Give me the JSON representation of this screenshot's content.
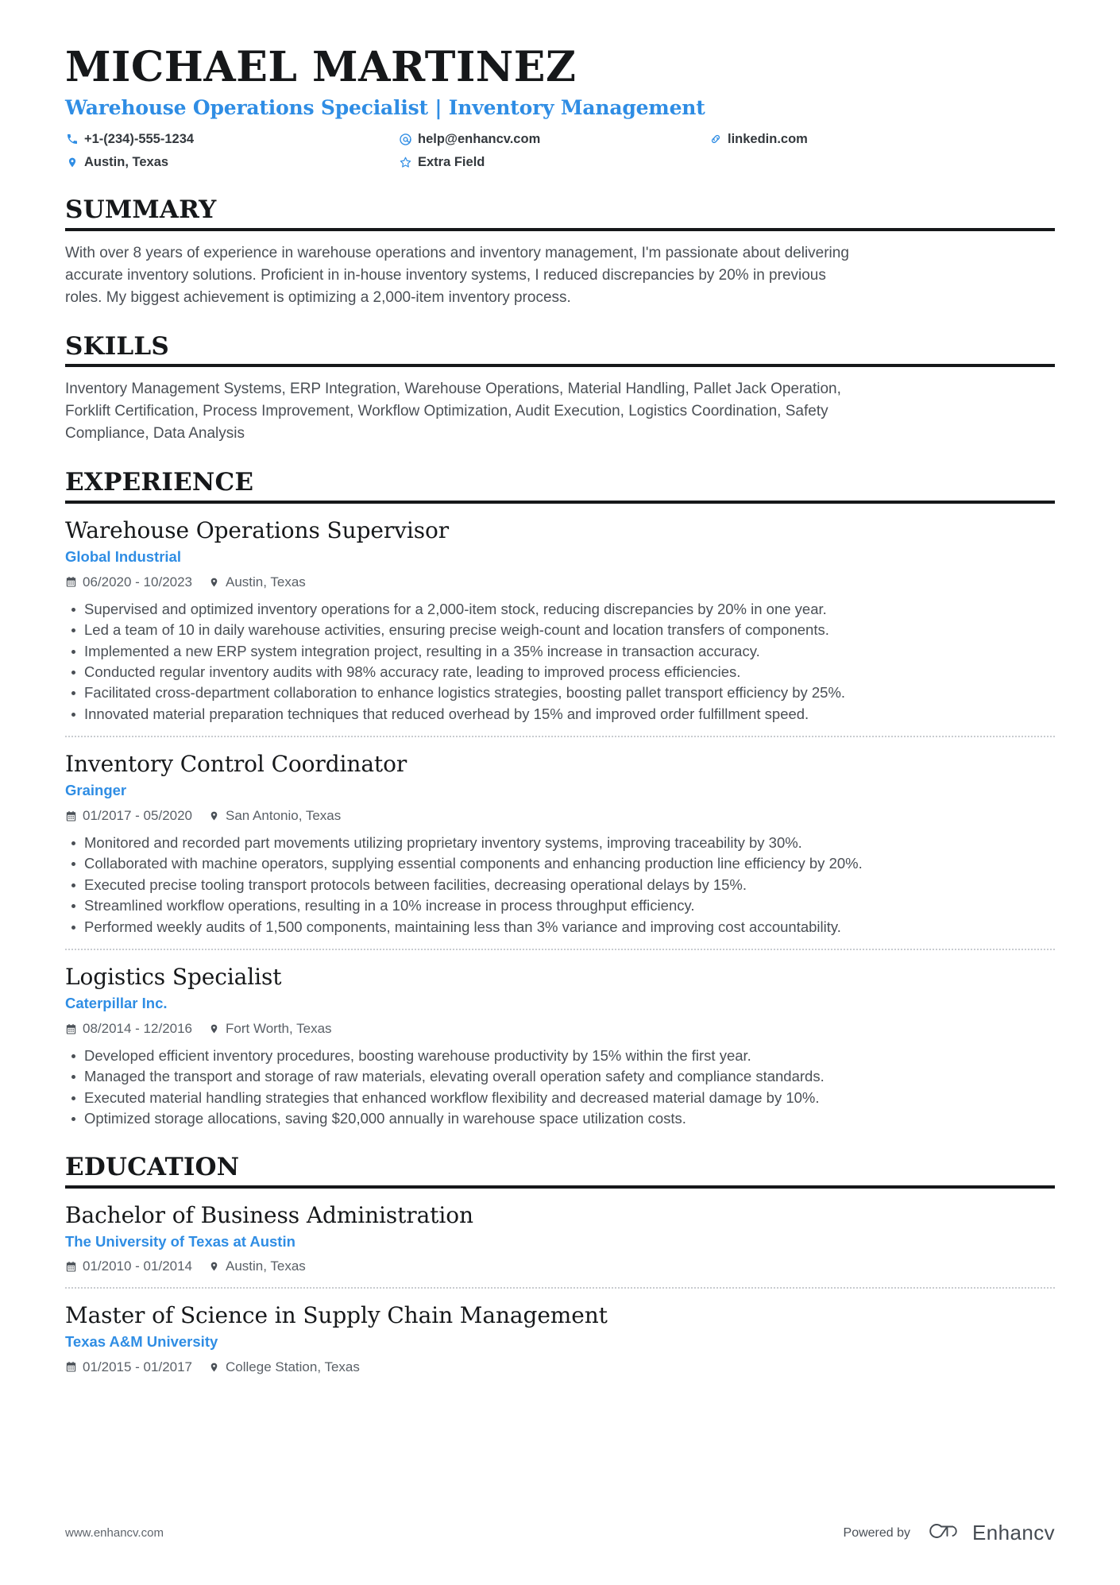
{
  "theme": {
    "accent": "#2f8de4",
    "ink": "#16181a",
    "body_text": "#4a4f55",
    "rule": "#16181a"
  },
  "header": {
    "name": "MICHAEL MARTINEZ",
    "headline": "Warehouse Operations Specialist | Inventory Management",
    "contacts": [
      {
        "icon": "phone-icon",
        "value": "+1-(234)-555-1234"
      },
      {
        "icon": "email-icon",
        "value": "help@enhancv.com"
      },
      {
        "icon": "link-icon",
        "value": "linkedin.com"
      },
      {
        "icon": "location-icon",
        "value": "Austin, Texas"
      },
      {
        "icon": "star-icon",
        "value": "Extra Field"
      }
    ]
  },
  "sections": {
    "summary": {
      "title": "SUMMARY",
      "text": "With over 8 years of experience in warehouse operations and inventory management, I'm passionate about delivering accurate inventory solutions. Proficient in in-house inventory systems, I reduced discrepancies by 20% in previous roles. My biggest achievement is optimizing a 2,000-item inventory process."
    },
    "skills": {
      "title": "SKILLS",
      "text": "Inventory Management Systems, ERP Integration, Warehouse Operations, Material Handling, Pallet Jack Operation, Forklift Certification, Process Improvement, Workflow Optimization, Audit Execution, Logistics Coordination, Safety Compliance, Data Analysis"
    },
    "experience": {
      "title": "EXPERIENCE",
      "entries": [
        {
          "title": "Warehouse Operations Supervisor",
          "org": "Global Industrial",
          "dates": "06/2020 - 10/2023",
          "location": "Austin, Texas",
          "bullets": [
            "Supervised and optimized inventory operations for a 2,000-item stock, reducing discrepancies by 20% in one year.",
            "Led a team of 10 in daily warehouse activities, ensuring precise weigh-count and location transfers of components.",
            "Implemented a new ERP system integration project, resulting in a 35% increase in transaction accuracy.",
            "Conducted regular inventory audits with 98% accuracy rate, leading to improved process efficiencies.",
            "Facilitated cross-department collaboration to enhance logistics strategies, boosting pallet transport efficiency by 25%.",
            "Innovated material preparation techniques that reduced overhead by 15% and improved order fulfillment speed."
          ]
        },
        {
          "title": "Inventory Control Coordinator",
          "org": "Grainger",
          "dates": "01/2017 - 05/2020",
          "location": "San Antonio, Texas",
          "bullets": [
            "Monitored and recorded part movements utilizing proprietary inventory systems, improving traceability by 30%.",
            "Collaborated with machine operators, supplying essential components and enhancing production line efficiency by 20%.",
            "Executed precise tooling transport protocols between facilities, decreasing operational delays by 15%.",
            "Streamlined workflow operations, resulting in a 10% increase in process throughput efficiency.",
            "Performed weekly audits of 1,500 components, maintaining less than 3% variance and improving cost accountability."
          ]
        },
        {
          "title": "Logistics Specialist",
          "org": "Caterpillar Inc.",
          "dates": "08/2014 - 12/2016",
          "location": "Fort Worth, Texas",
          "bullets": [
            "Developed efficient inventory procedures, boosting warehouse productivity by 15% within the first year.",
            "Managed the transport and storage of raw materials, elevating overall operation safety and compliance standards.",
            "Executed material handling strategies that enhanced workflow flexibility and decreased material damage by 10%.",
            "Optimized storage allocations, saving $20,000 annually in warehouse space utilization costs."
          ]
        }
      ]
    },
    "education": {
      "title": "EDUCATION",
      "entries": [
        {
          "title": "Bachelor of Business Administration",
          "org": "The University of Texas at Austin",
          "dates": "01/2010 - 01/2014",
          "location": "Austin, Texas"
        },
        {
          "title": "Master of Science in Supply Chain Management",
          "org": "Texas A&M University",
          "dates": "01/2015 - 01/2017",
          "location": "College Station, Texas"
        }
      ]
    }
  },
  "footer": {
    "url": "www.enhancv.com",
    "powered_by": "Powered by",
    "brand": "Enhancv"
  }
}
